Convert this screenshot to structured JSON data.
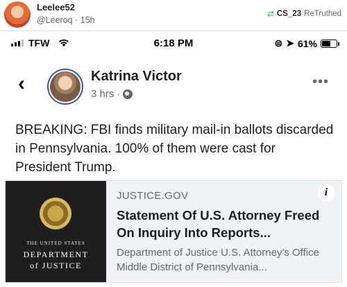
{
  "outer": {
    "name": "Leelee52",
    "handle": "@Leeroq",
    "age": "15h",
    "retruth_user": "CS_23",
    "retruth_label": "ReTruthed"
  },
  "status_bar": {
    "carrier": "TFW",
    "time": "6:18 PM",
    "battery": "61%",
    "battery_level": 0.61
  },
  "post": {
    "author": "Katrina Victor",
    "time": "3 hrs",
    "separator": "·",
    "text": "BREAKING: FBI finds military mail-in ballots discarded in Pennsylvania. 100% of them were cast for President Trump.",
    "more": "•••"
  },
  "link_card": {
    "image_text_1": "THE UNITED STATES",
    "image_text_2": "DEPARTMENT",
    "image_text_3": "of JUSTICE",
    "domain": "JUSTICE.GOV",
    "title": "Statement Of U.S. Attorney Freed On Inquiry Into Reports...",
    "description": "Department of Justice U.S. Attorney's Office Middle District of Pennsylvania..."
  },
  "icons": {
    "back": "chevron-left-icon",
    "globe": "globe-icon",
    "info": "info-icon",
    "retruth": "retruth-icon",
    "wifi": "wifi-icon",
    "location": "location-arrow-icon",
    "rotation_lock": "rotation-lock-icon"
  },
  "colors": {
    "retruth_green": "#2db84b",
    "avatar_ring": "#3b5998",
    "card_bg": "#f0f2f5"
  }
}
